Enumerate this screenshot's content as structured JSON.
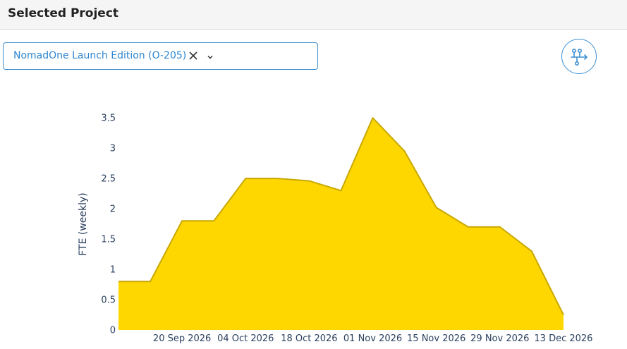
{
  "header": {
    "title": "Selected Project"
  },
  "project_select": {
    "value": "NomadOne Launch Edition (O-205)",
    "clear_icon": "close-icon",
    "toggle_icon": "chevron-down-icon",
    "border_color": "#3d8fd1",
    "text_color": "#2f86cf"
  },
  "flow_button": {
    "icon": "flow-diagram-icon",
    "color": "#3d8fd1"
  },
  "chart_data": {
    "type": "area",
    "ylabel": "FTE (weekly)",
    "xlabel": "",
    "title": "",
    "fill_color": "#ffd700",
    "line_color": "#c9a800",
    "ylim": [
      0,
      3.7
    ],
    "yticks": [
      0,
      0.5,
      1,
      1.5,
      2,
      2.5,
      3,
      3.5
    ],
    "ytick_labels": [
      "0",
      "0.5",
      "1",
      "1.5",
      "2",
      "2.5",
      "3",
      "3.5"
    ],
    "xlim": [
      "2026-09-06",
      "2026-12-20"
    ],
    "xticks": [
      "2026-09-20",
      "2026-10-04",
      "2026-10-18",
      "2026-11-01",
      "2026-11-15",
      "2026-11-29",
      "2026-12-13"
    ],
    "xtick_labels": [
      "20 Sep 2026",
      "04 Oct 2026",
      "18 Oct 2026",
      "01 Nov 2026",
      "15 Nov 2026",
      "29 Nov 2026",
      "13 Dec 2026"
    ],
    "x": [
      "2026-09-06",
      "2026-09-13",
      "2026-09-20",
      "2026-09-27",
      "2026-10-04",
      "2026-10-11",
      "2026-10-18",
      "2026-10-25",
      "2026-11-01",
      "2026-11-08",
      "2026-11-15",
      "2026-11-22",
      "2026-11-29",
      "2026-12-06",
      "2026-12-13",
      "2026-12-20"
    ],
    "series": [
      {
        "values": [
          0.8,
          0.8,
          1.8,
          1.8,
          2.5,
          2.5,
          2.46,
          2.3,
          3.5,
          2.95,
          2.02,
          1.7,
          1.7,
          1.3,
          0.25
        ]
      }
    ],
    "grid": false,
    "legend": "none"
  }
}
